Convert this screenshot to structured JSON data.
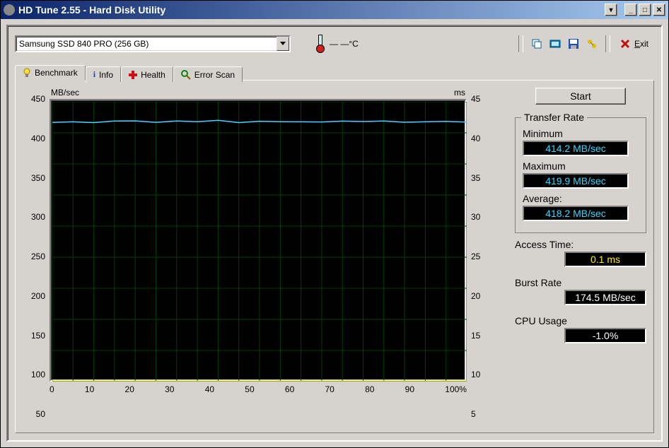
{
  "window": {
    "title": "HD Tune 2.55 - Hard Disk Utility"
  },
  "combo": {
    "selected": "Samsung SSD 840 PRO (256 GB)"
  },
  "temperature": {
    "value": "— —°C"
  },
  "exit": {
    "label": "Exit"
  },
  "tabs": [
    {
      "label": "Benchmark",
      "icon": "lightbulb"
    },
    {
      "label": "Info",
      "icon": "info"
    },
    {
      "label": "Health",
      "icon": "plus"
    },
    {
      "label": "Error Scan",
      "icon": "magnifier"
    }
  ],
  "chart_data": {
    "type": "line",
    "x": [
      0,
      5,
      10,
      15,
      20,
      25,
      30,
      35,
      40,
      45,
      50,
      55,
      60,
      65,
      70,
      75,
      80,
      85,
      90,
      95,
      100
    ],
    "series": [
      {
        "name": "Transfer Rate (MB/sec)",
        "axis": "left",
        "color": "#4fd0ff",
        "values": [
          416,
          418,
          417,
          419,
          418,
          418,
          419,
          418,
          419,
          418,
          418,
          418,
          417,
          419,
          418,
          418,
          419,
          418,
          417,
          418,
          418
        ]
      },
      {
        "name": "Access Time (ms)",
        "axis": "right",
        "color": "#ffee00",
        "values": [
          0.1,
          0.1,
          0.1,
          0.1,
          0.1,
          0.1,
          0.1,
          0.1,
          0.1,
          0.1,
          0.1,
          0.1,
          0.1,
          0.1,
          0.1,
          0.1,
          0.1,
          0.1,
          0.1,
          0.1,
          0.1
        ]
      }
    ],
    "ylabel_left": "MB/sec",
    "ylabel_right": "ms",
    "ylim_left": [
      0,
      450
    ],
    "ylim_right": [
      0,
      45
    ],
    "yticks_left": [
      50,
      100,
      150,
      200,
      250,
      300,
      350,
      400,
      450
    ],
    "yticks_right": [
      5,
      10,
      15,
      20,
      25,
      30,
      35,
      40,
      45
    ],
    "xticks": [
      0,
      10,
      20,
      30,
      40,
      50,
      60,
      70,
      80,
      90,
      100
    ],
    "xunit": "%"
  },
  "start_label": "Start",
  "transfer": {
    "group": "Transfer Rate",
    "min_label": "Minimum",
    "min_value": "414.2 MB/sec",
    "max_label": "Maximum",
    "max_value": "419.9 MB/sec",
    "avg_label": "Average:",
    "avg_value": "418.2 MB/sec"
  },
  "access": {
    "label": "Access Time:",
    "value": "0.1 ms"
  },
  "burst": {
    "label": "Burst Rate",
    "value": "174.5 MB/sec"
  },
  "cpu": {
    "label": "CPU Usage",
    "value": "-1.0%"
  }
}
